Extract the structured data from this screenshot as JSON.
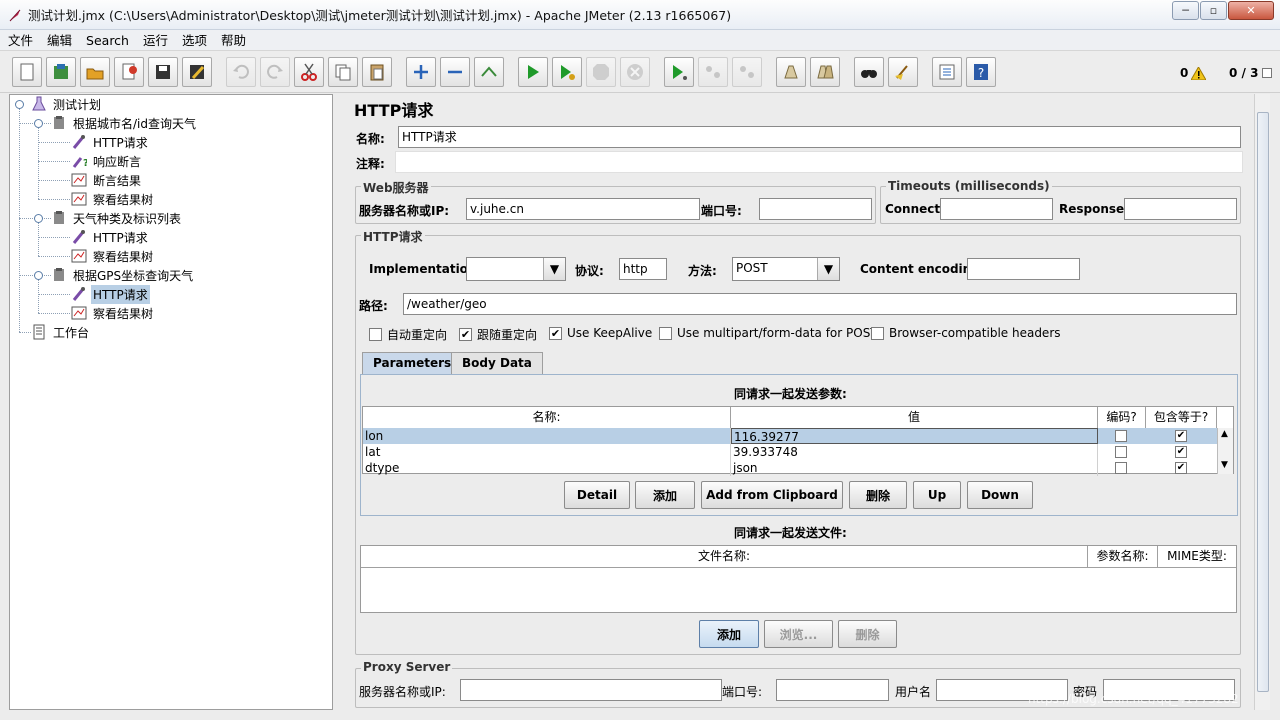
{
  "window": {
    "title": "测试计划.jmx (C:\\Users\\Administrator\\Desktop\\测试\\jmeter测试计划\\测试计划.jmx) - Apache JMeter (2.13 r1665067)",
    "min": "─",
    "max": "▫",
    "close": "✕"
  },
  "menu": [
    "文件",
    "编辑",
    "Search",
    "运行",
    "选项",
    "帮助"
  ],
  "toolbar": {
    "warnings": "0",
    "threads": "0 / 3"
  },
  "tree": {
    "root": "测试计划",
    "groups": [
      {
        "label": "根据城市名/id查询天气",
        "children": [
          "HTTP请求",
          "响应断言",
          "断言结果",
          "察看结果树"
        ]
      },
      {
        "label": "天气种类及标识列表",
        "children": [
          "HTTP请求",
          "察看结果树"
        ]
      },
      {
        "label": "根据GPS坐标查询天气",
        "children": [
          "HTTP请求",
          "察看结果树"
        ]
      }
    ],
    "workbench": "工作台"
  },
  "form": {
    "heading": "HTTP请求",
    "name_label": "名称:",
    "name_value": "HTTP请求",
    "comment_label": "注释:",
    "web_server": {
      "title": "Web服务器",
      "server_label": "服务器名称或IP:",
      "server_value": "v.juhe.cn",
      "port_label": "端口号:",
      "port_value": ""
    },
    "timeouts": {
      "title": "Timeouts (milliseconds)",
      "connect_label": "Connect:",
      "response_label": "Response:"
    },
    "http": {
      "title": "HTTP请求",
      "impl_label": "Implementation:",
      "impl_value": "",
      "protocol_label": "协议:",
      "protocol_value": "http",
      "method_label": "方法:",
      "method_value": "POST",
      "encoding_label": "Content encoding:",
      "path_label": "路径:",
      "path_value": "/weather/geo"
    },
    "options": [
      {
        "label": "自动重定向",
        "checked": false
      },
      {
        "label": "跟随重定向",
        "checked": true
      },
      {
        "label": "Use KeepAlive",
        "checked": true
      },
      {
        "label": "Use multipart/form-data for POST",
        "checked": false
      },
      {
        "label": "Browser-compatible headers",
        "checked": false
      }
    ],
    "tabs": [
      "Parameters",
      "Body Data"
    ],
    "params_title": "同请求一起发送参数:",
    "params_headers": [
      "名称:",
      "值",
      "编码?",
      "包含等于?"
    ],
    "params_rows": [
      {
        "name": "lon",
        "value": "116.39277",
        "encode": false,
        "include_equals": true
      },
      {
        "name": "lat",
        "value": "39.933748",
        "encode": false,
        "include_equals": true
      },
      {
        "name": "dtype",
        "value": "json",
        "encode": false,
        "include_equals": true
      }
    ],
    "param_buttons": [
      "Detail",
      "添加",
      "Add from Clipboard",
      "删除",
      "Up",
      "Down"
    ],
    "files_title": "同请求一起发送文件:",
    "files_headers": [
      "文件名称:",
      "参数名称:",
      "MIME类型:"
    ],
    "file_buttons": [
      "添加",
      "浏览...",
      "删除"
    ],
    "proxy": {
      "title": "Proxy Server",
      "server_label": "服务器名称或IP:",
      "port_label": "端口号:",
      "user_label": "用户名",
      "password_label": "密码"
    }
  },
  "watermark": "https://blog.csdn.net/qq_41773282"
}
